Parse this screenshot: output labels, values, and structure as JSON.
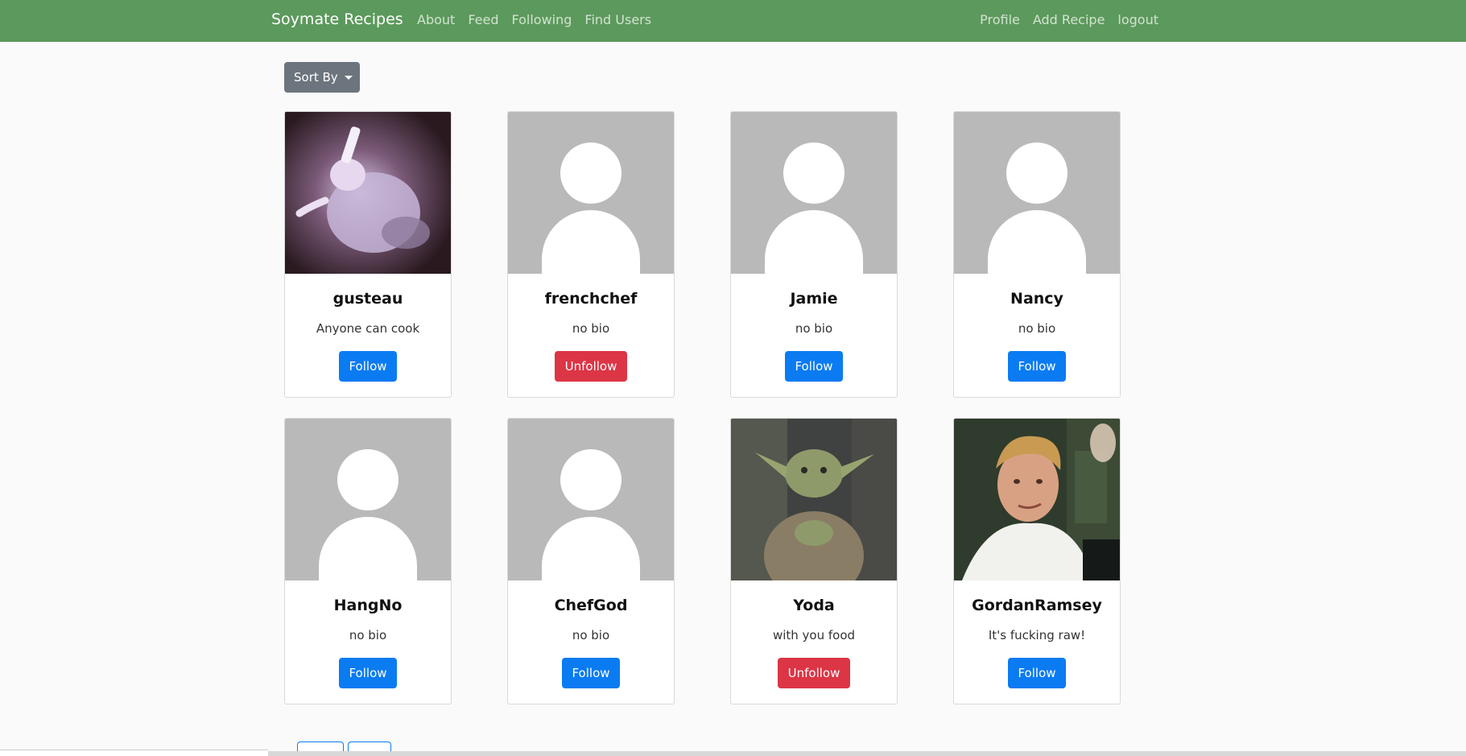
{
  "navbar": {
    "brand": "Soymate Recipes",
    "left_links": [
      "About",
      "Feed",
      "Following",
      "Find Users"
    ],
    "right_links": [
      "Profile",
      "Add Recipe",
      "logout"
    ],
    "color": "#5c995c"
  },
  "sort": {
    "label": "Sort By"
  },
  "users": [
    {
      "name": "gusteau",
      "bio": "Anyone can cook",
      "action": "Follow",
      "avatar": "photo-gusteau"
    },
    {
      "name": "frenchchef",
      "bio": "no bio",
      "action": "Unfollow",
      "avatar": "default-avatar"
    },
    {
      "name": "Jamie",
      "bio": "no bio",
      "action": "Follow",
      "avatar": "default-avatar"
    },
    {
      "name": "Nancy",
      "bio": "no bio",
      "action": "Follow",
      "avatar": "default-avatar"
    },
    {
      "name": "HangNo",
      "bio": "no bio",
      "action": "Follow",
      "avatar": "default-avatar"
    },
    {
      "name": "ChefGod",
      "bio": "no bio",
      "action": "Follow",
      "avatar": "default-avatar"
    },
    {
      "name": "Yoda",
      "bio": "with you food",
      "action": "Unfollow",
      "avatar": "photo-yoda"
    },
    {
      "name": "GordanRamsey",
      "bio": "It's fucking raw!",
      "action": "Follow",
      "avatar": "photo-gordon"
    }
  ],
  "colors": {
    "follow": "#0b7bf2",
    "unfollow": "#dc3545",
    "sort": "#6c757d"
  }
}
